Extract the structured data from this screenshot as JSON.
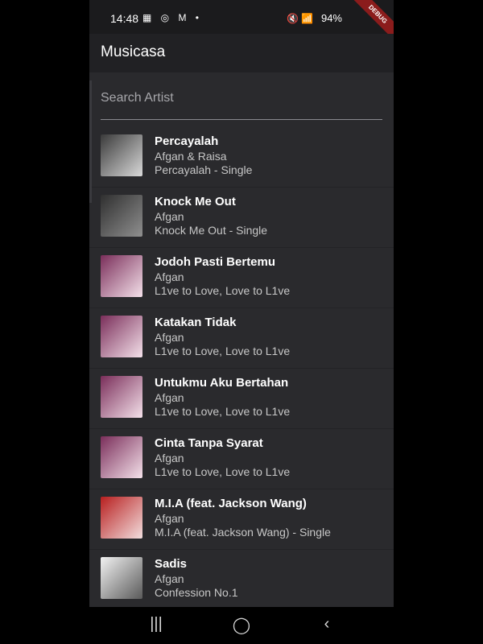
{
  "status_bar": {
    "time": "14:48",
    "left_icons": "▦ ◎ M •",
    "right_icons": "🔇 📶",
    "battery": "94%"
  },
  "debug_banner": "DEBUG",
  "app": {
    "title": "Musicasa"
  },
  "search": {
    "placeholder": "Search Artist",
    "value": ""
  },
  "tracks": [
    {
      "title": "Percayalah",
      "artist": "Afgan & Raisa",
      "album": "Percayalah - Single",
      "thumb_colors": [
        "#3a3a3a",
        "#d9d9d9"
      ]
    },
    {
      "title": "Knock Me Out",
      "artist": "Afgan",
      "album": "Knock Me Out - Single",
      "thumb_colors": [
        "#2f2f2f",
        "#8f8f8f"
      ]
    },
    {
      "title": "Jodoh Pasti Bertemu",
      "artist": "Afgan",
      "album": "L1ve to Love, Love to L1ve",
      "thumb_colors": [
        "#7a2e5a",
        "#f4e1ea"
      ]
    },
    {
      "title": "Katakan Tidak",
      "artist": "Afgan",
      "album": "L1ve to Love, Love to L1ve",
      "thumb_colors": [
        "#7a2e5a",
        "#f4e1ea"
      ]
    },
    {
      "title": "Untukmu Aku Bertahan",
      "artist": "Afgan",
      "album": "L1ve to Love, Love to L1ve",
      "thumb_colors": [
        "#7a2e5a",
        "#f4e1ea"
      ]
    },
    {
      "title": "Cinta Tanpa Syarat",
      "artist": "Afgan",
      "album": "L1ve to Love, Love to L1ve",
      "thumb_colors": [
        "#7a2e5a",
        "#f4e1ea"
      ]
    },
    {
      "title": "M.I.A (feat. Jackson Wang)",
      "artist": "Afgan",
      "album": "M.I.A (feat. Jackson Wang) - Single",
      "thumb_colors": [
        "#b81f1f",
        "#f2dede"
      ]
    },
    {
      "title": "Sadis",
      "artist": "Afgan",
      "album": "Confession No.1",
      "thumb_colors": [
        "#f2f2f2",
        "#5a5a5a"
      ]
    }
  ],
  "nav": {
    "recents": "|||",
    "home": "◯",
    "back": "‹"
  }
}
